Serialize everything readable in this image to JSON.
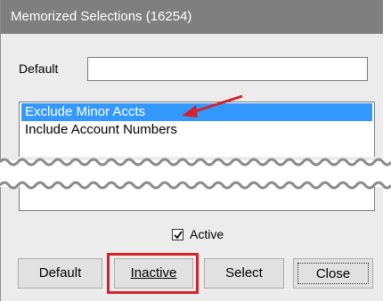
{
  "window": {
    "title": "Memorized Selections (16254)"
  },
  "default_field": {
    "label": "Default",
    "value": ""
  },
  "list": {
    "items": [
      {
        "label": "Exclude Minor Accts",
        "selected": true
      },
      {
        "label": "Include Account Numbers",
        "selected": false
      }
    ]
  },
  "active_checkbox": {
    "label": "Active",
    "checked": true
  },
  "buttons": {
    "default": "Default",
    "inactive": "Inactive",
    "select": "Select",
    "close": "Close"
  },
  "colors": {
    "titlebar": "#7f7f7f",
    "selection": "#3399ff",
    "annotation": "#d2232a"
  }
}
